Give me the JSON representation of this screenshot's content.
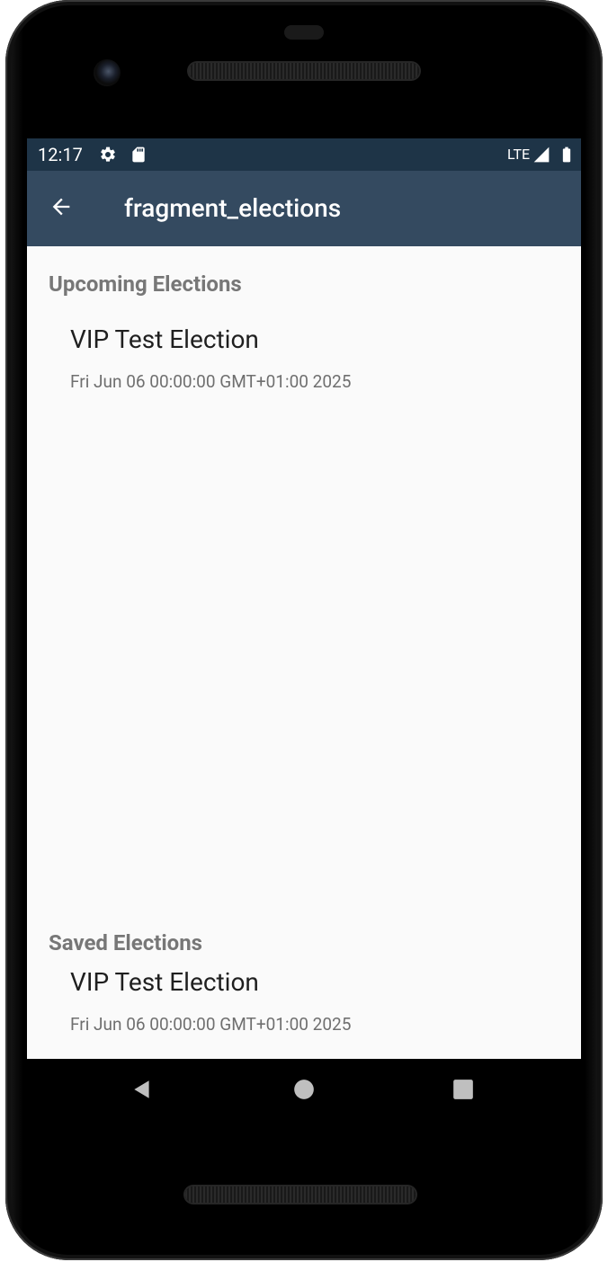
{
  "status_bar": {
    "time": "12:17",
    "network": "LTE",
    "icons": [
      "settings-icon",
      "sd-card-icon",
      "signal-icon",
      "battery-icon"
    ]
  },
  "app_bar": {
    "title": "fragment_elections",
    "back_icon": "arrow-back-icon"
  },
  "upcoming": {
    "header": "Upcoming Elections",
    "items": [
      {
        "name": "VIP Test Election",
        "date": "Fri Jun 06 00:00:00 GMT+01:00 2025"
      }
    ]
  },
  "saved": {
    "header": "Saved Elections",
    "items": [
      {
        "name": "VIP Test Election",
        "date": "Fri Jun 06 00:00:00 GMT+01:00 2025"
      }
    ]
  },
  "nav_bar": {
    "buttons": [
      "back-triangle-icon",
      "home-circle-icon",
      "recents-square-icon"
    ]
  },
  "colors": {
    "status_bar": "#1e3447",
    "app_bar": "#344a60",
    "background": "#fafafa",
    "header_text": "#777777",
    "title_text": "#1f1f1f",
    "date_text": "#6f6f6f"
  }
}
